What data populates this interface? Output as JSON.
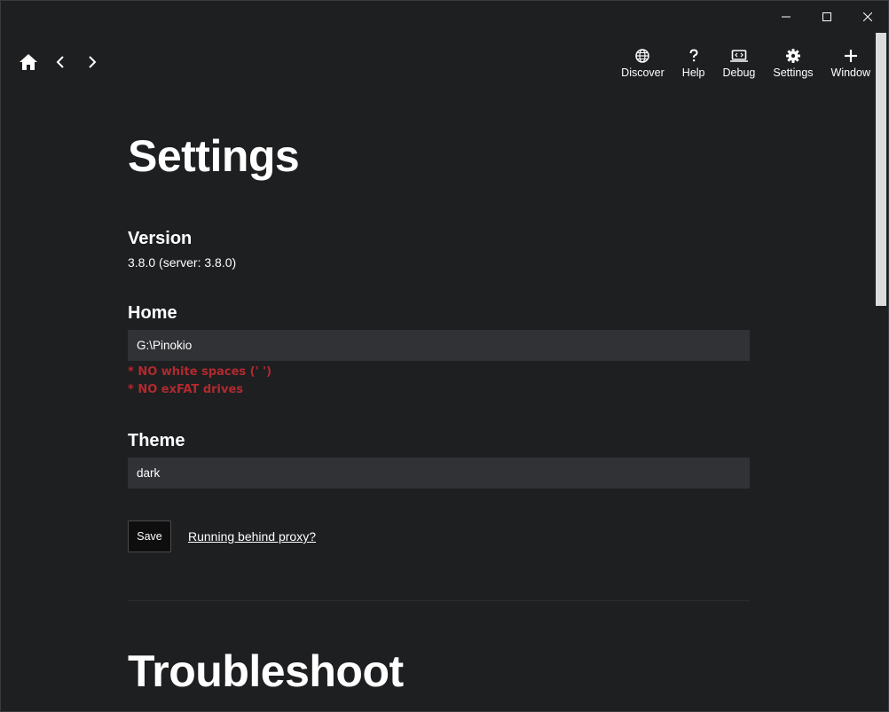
{
  "window": {
    "controls": {
      "minimize": "minimize",
      "maximize": "maximize",
      "close": "close"
    }
  },
  "nav": {
    "left": {
      "home_icon": "home-icon",
      "back_icon": "chevron-left-icon",
      "forward_icon": "chevron-right-icon"
    },
    "items": [
      {
        "label": "Discover",
        "icon": "globe-icon"
      },
      {
        "label": "Help",
        "icon": "question-icon"
      },
      {
        "label": "Debug",
        "icon": "debug-icon"
      },
      {
        "label": "Settings",
        "icon": "gear-icon"
      },
      {
        "label": "Window",
        "icon": "plus-icon"
      }
    ]
  },
  "page": {
    "title": "Settings",
    "version": {
      "label": "Version",
      "value": "3.8.0 (server: 3.8.0)"
    },
    "home": {
      "label": "Home",
      "value": "G:\\Pinokio",
      "warnings": [
        "* NO white spaces (' ')",
        "* NO exFAT drives"
      ]
    },
    "theme": {
      "label": "Theme",
      "value": "dark"
    },
    "save_label": "Save",
    "proxy_link": "Running behind proxy?",
    "troubleshoot_title": "Troubleshoot"
  },
  "colors": {
    "background": "#1e1f21",
    "input_bg": "#313235",
    "warning": "#b02a2e",
    "text": "#ffffff"
  }
}
